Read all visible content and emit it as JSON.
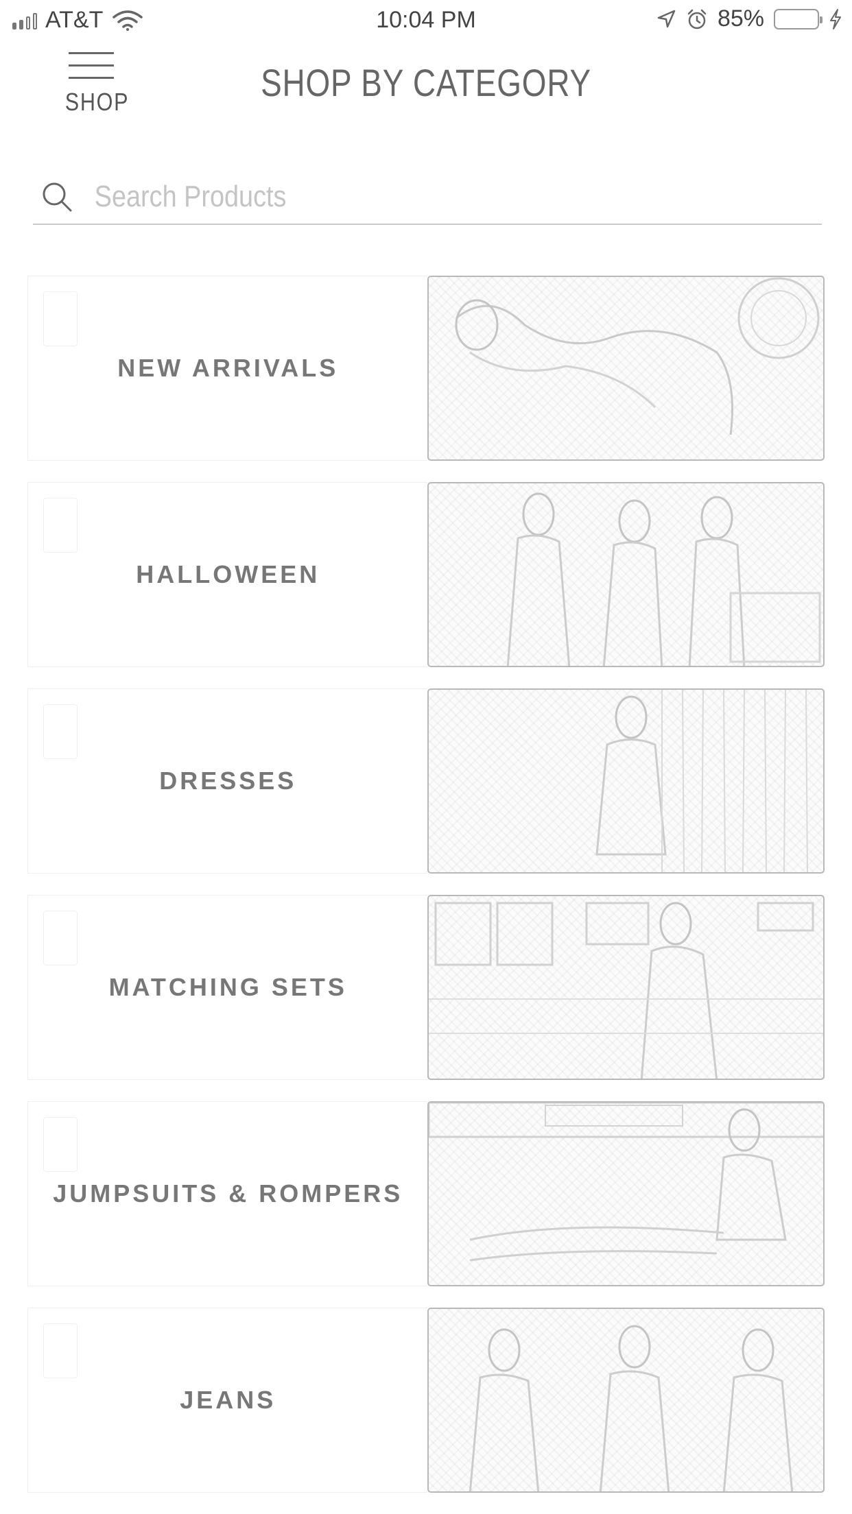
{
  "status_bar": {
    "carrier": "AT&T",
    "time": "10:04 PM",
    "battery": "85%"
  },
  "header": {
    "menu_label": "SHOP",
    "title": "SHOP BY CATEGORY"
  },
  "search": {
    "placeholder": "Search Products"
  },
  "categories": [
    {
      "label": "NEW ARRIVALS"
    },
    {
      "label": "HALLOWEEN"
    },
    {
      "label": "DRESSES"
    },
    {
      "label": "MATCHING SETS"
    },
    {
      "label": "JUMPSUITS & ROMPERS"
    },
    {
      "label": "JEANS"
    }
  ]
}
